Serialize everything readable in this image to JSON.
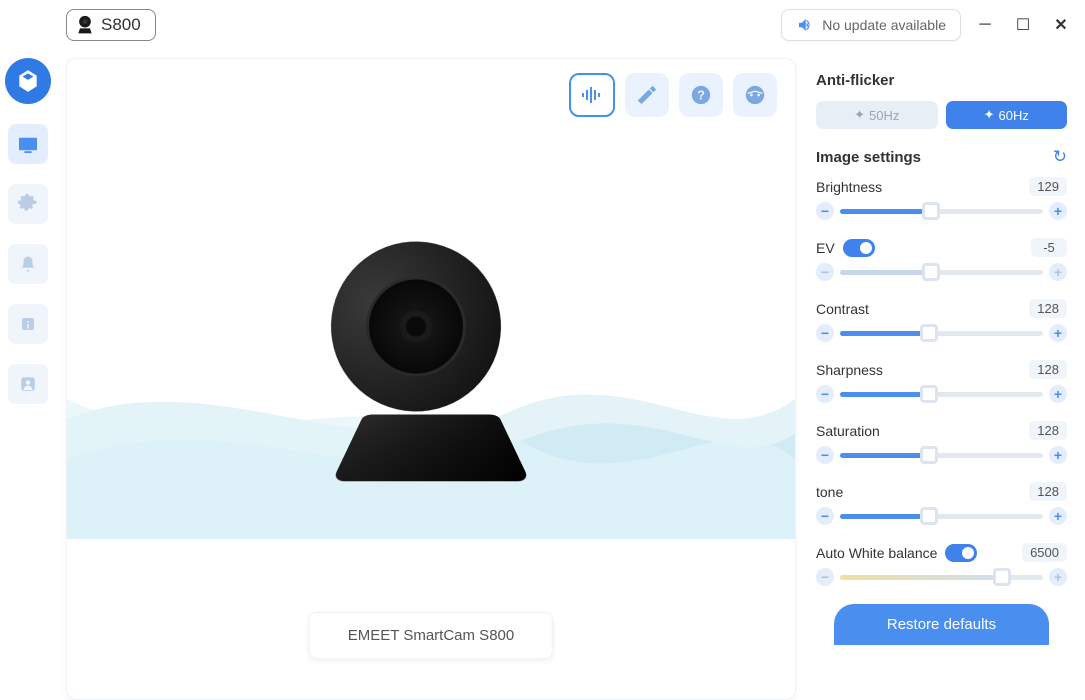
{
  "titlebar": {
    "device": "S800",
    "update_text": "No update available"
  },
  "preview": {
    "product_name": "EMEET SmartCam S800"
  },
  "panel": {
    "antiflicker": {
      "title": "Anti-flicker",
      "options": [
        "50Hz",
        "60Hz"
      ],
      "selected_index": 1
    },
    "image_settings_title": "Image settings",
    "settings": [
      {
        "label": "Brightness",
        "value": "129",
        "percent": 45,
        "toggle": null,
        "disabled": false
      },
      {
        "label": "EV",
        "value": "-5",
        "percent": 45,
        "toggle": true,
        "disabled": true
      },
      {
        "label": "Contrast",
        "value": "128",
        "percent": 44,
        "toggle": null,
        "disabled": false
      },
      {
        "label": "Sharpness",
        "value": "128",
        "percent": 44,
        "toggle": null,
        "disabled": false
      },
      {
        "label": "Saturation",
        "value": "128",
        "percent": 44,
        "toggle": null,
        "disabled": false
      },
      {
        "label": "tone",
        "value": "128",
        "percent": 44,
        "toggle": null,
        "disabled": false
      },
      {
        "label": "Auto White balance",
        "value": "6500",
        "percent": 80,
        "toggle": true,
        "disabled": true,
        "wb": true
      }
    ],
    "restore_label": "Restore defaults"
  }
}
